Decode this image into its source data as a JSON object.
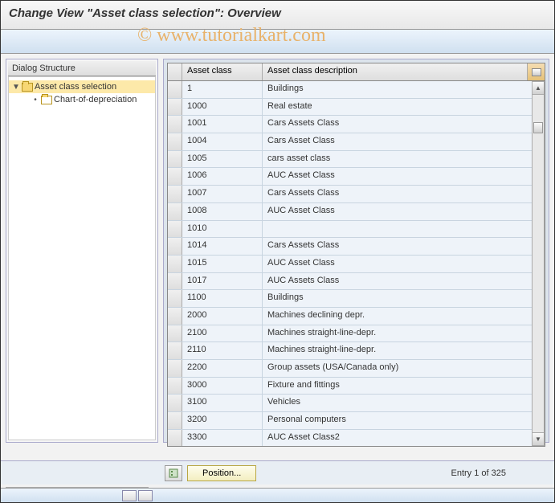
{
  "header": {
    "title": "Change View \"Asset class selection\": Overview"
  },
  "watermark": "© www.tutorialkart.com",
  "tree": {
    "header": "Dialog Structure",
    "root": {
      "label": "Asset class selection"
    },
    "child": {
      "label": "Chart-of-depreciation"
    }
  },
  "grid": {
    "headers": {
      "col1": "Asset class",
      "col2": "Asset class description"
    },
    "rows": [
      {
        "code": "1",
        "desc": "Buildings"
      },
      {
        "code": "1000",
        "desc": "Real estate"
      },
      {
        "code": "1001",
        "desc": "Cars Assets Class"
      },
      {
        "code": "1004",
        "desc": "Cars Asset Class"
      },
      {
        "code": "1005",
        "desc": "cars asset class"
      },
      {
        "code": "1006",
        "desc": "AUC Asset Class"
      },
      {
        "code": "1007",
        "desc": "Cars Assets Class"
      },
      {
        "code": "1008",
        "desc": "AUC Asset Class"
      },
      {
        "code": "1010",
        "desc": ""
      },
      {
        "code": "1014",
        "desc": "Cars Assets Class"
      },
      {
        "code": "1015",
        "desc": "AUC Asset Class"
      },
      {
        "code": "1017",
        "desc": "AUC Assets Class"
      },
      {
        "code": "1100",
        "desc": "Buildings"
      },
      {
        "code": "2000",
        "desc": "Machines declining depr."
      },
      {
        "code": "2100",
        "desc": "Machines straight-line-depr."
      },
      {
        "code": "2110",
        "desc": "Machines straight-line-depr."
      },
      {
        "code": "2200",
        "desc": "Group assets (USA/Canada only)"
      },
      {
        "code": "3000",
        "desc": "Fixture and fittings"
      },
      {
        "code": "3100",
        "desc": "Vehicles"
      },
      {
        "code": "3200",
        "desc": "Personal computers"
      },
      {
        "code": "3300",
        "desc": "AUC Asset Class2"
      }
    ]
  },
  "footer": {
    "position_button": "Position...",
    "entry_status": "Entry 1 of 325"
  }
}
